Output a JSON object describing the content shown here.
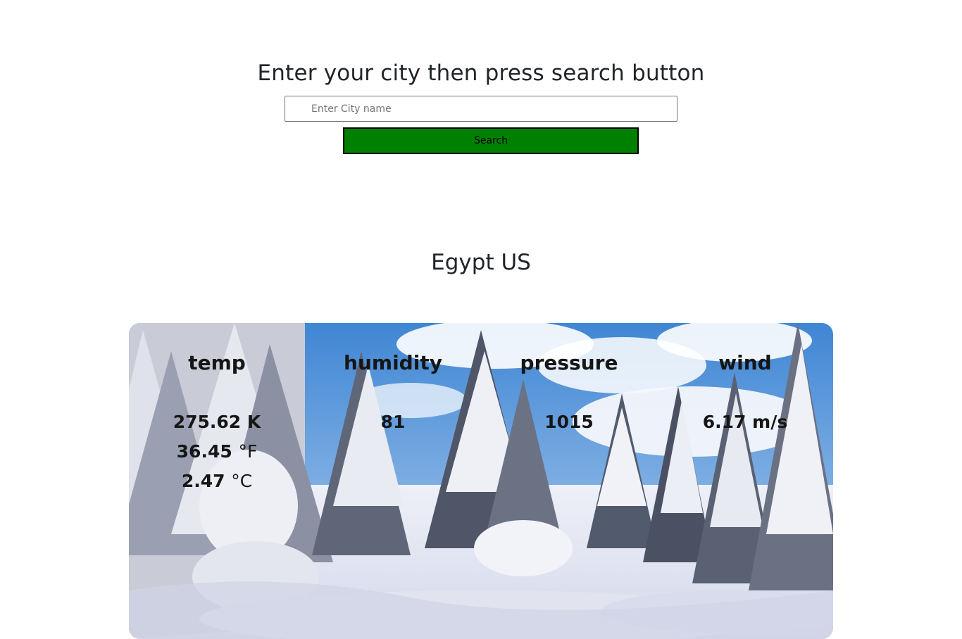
{
  "search": {
    "heading": "Enter your city then press search button",
    "input_placeholder": "Enter City name",
    "input_value": "",
    "button_label": "Search"
  },
  "location": {
    "label": "Egypt US"
  },
  "weather": {
    "background": "snowy-forest-image",
    "colors": {
      "button": "#008000",
      "sky": "#4a8fd6",
      "snow": "#e9ecf6"
    },
    "temp": {
      "title": "temp",
      "kelvin": {
        "value": "275.62",
        "unit": "K"
      },
      "fahrenheit": {
        "value": "36.45",
        "unit": "°F"
      },
      "celsius": {
        "value": "2.47",
        "unit": "°C"
      }
    },
    "humidity": {
      "title": "humidity",
      "value": "81"
    },
    "pressure": {
      "title": "pressure",
      "value": "1015"
    },
    "wind": {
      "title": "wind",
      "value": "6.17 m/s"
    }
  }
}
